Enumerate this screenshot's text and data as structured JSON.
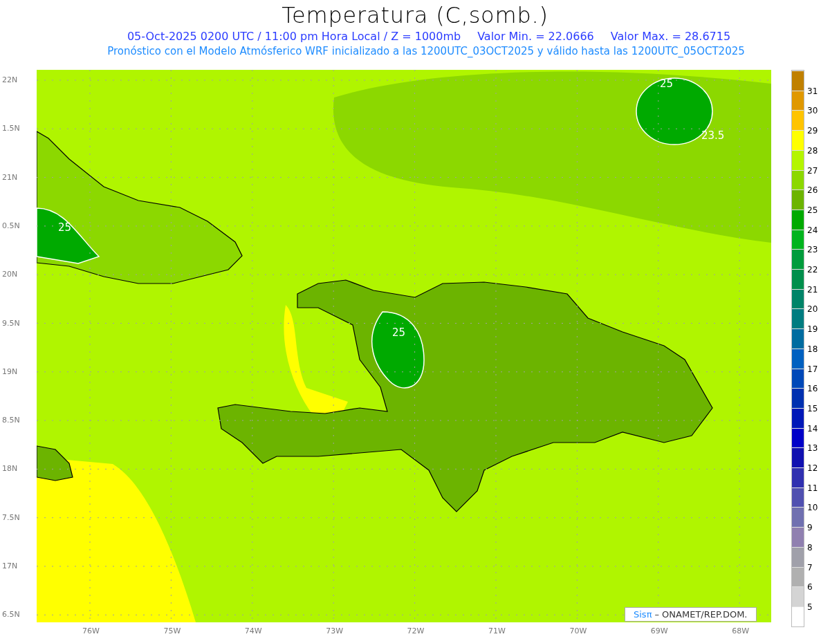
{
  "title": "Temperatura (C,somb.)",
  "subtitle": {
    "valid_time": "05-Oct-2025 0200 UTC / 11:00 pm Hora Local / Z = 1000mb",
    "min": "Valor Min. = 22.0666",
    "max": "Valor Max. = 28.6715"
  },
  "model_line": "Pronóstico con el Modelo Atmósferico WRF inicializado a las 1200UTC_03OCT2025 y válido hasta las  1200UTC_05OCT2025",
  "map": {
    "lat_labels": [
      "22N",
      "1.5N",
      "21N",
      "0.5N",
      "20N",
      "9.5N",
      "19N",
      "8.5N",
      "18N",
      "7.5N",
      "17N",
      "6.5N"
    ],
    "lon_labels": [
      "76W",
      "75W",
      "74W",
      "73W",
      "72W",
      "71W",
      "70W",
      "69W",
      "68W"
    ],
    "contour_labels": [
      "25",
      "23.5",
      "25",
      "25"
    ],
    "credit": {
      "brand": "Sisπ",
      "text": "– ONAMET/REP.DOM."
    }
  },
  "legend": {
    "bins": [
      {
        "color": "#c08000"
      },
      {
        "color": "#e09800"
      },
      {
        "color": "#ffc400"
      },
      {
        "color": "#ffff00"
      },
      {
        "color": "#b4f500"
      },
      {
        "color": "#8cd800"
      },
      {
        "color": "#6cb400"
      },
      {
        "color": "#00aa00"
      },
      {
        "color": "#00b41e"
      },
      {
        "color": "#009c3c"
      },
      {
        "color": "#008f4c"
      },
      {
        "color": "#008468"
      },
      {
        "color": "#007c80"
      },
      {
        "color": "#006ca0"
      },
      {
        "color": "#0060c0"
      },
      {
        "color": "#0048b8"
      },
      {
        "color": "#0030b0"
      },
      {
        "color": "#0018b8"
      },
      {
        "color": "#0000c8"
      },
      {
        "color": "#1010b0"
      },
      {
        "color": "#3030b0"
      },
      {
        "color": "#5050b0"
      },
      {
        "color": "#7070b0"
      },
      {
        "color": "#9080b0"
      },
      {
        "color": "#a0a0aa"
      },
      {
        "color": "#b0b0b0"
      },
      {
        "color": "#d4d4d4"
      },
      {
        "color": "#ffffff"
      }
    ],
    "labels": [
      "31",
      "30",
      "29",
      "28",
      "27",
      "26",
      "25",
      "24",
      "23",
      "22",
      "21",
      "20",
      "19",
      "18",
      "17",
      "16",
      "15",
      "14",
      "13",
      "12",
      "11",
      "10",
      "9",
      "8",
      "7",
      "6",
      "5"
    ]
  }
}
